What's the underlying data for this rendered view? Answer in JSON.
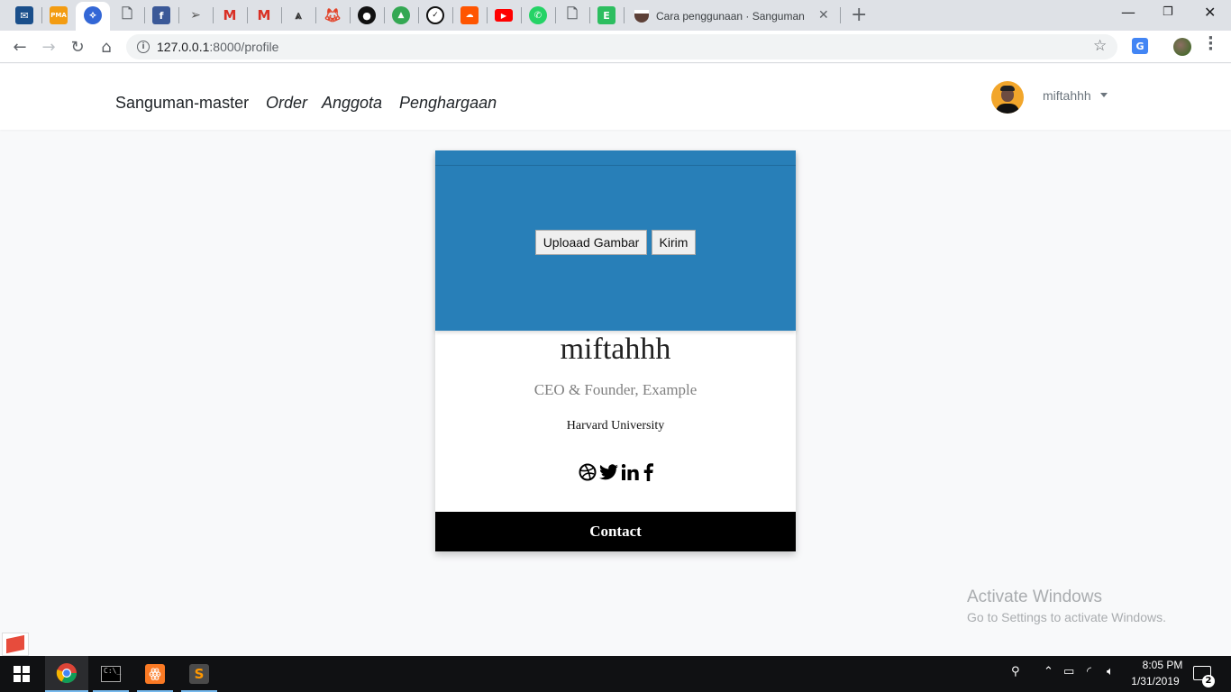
{
  "browser": {
    "tabs_icons": [
      "mail-icon",
      "phpmyadmin-icon",
      "chromium-icon",
      "doc-icon",
      "facebook-icon",
      "send-icon",
      "gmail-icon",
      "gmail-icon",
      "altair-icon",
      "gitlab-icon",
      "github-icon",
      "map-icon",
      "timer-icon",
      "soundcloud-icon",
      "youtube-icon",
      "whatsapp-icon",
      "doc-icon",
      "evernote-icon"
    ],
    "active_tab_title": "Cara penggunaan · Sanguman",
    "url_host": "127.0.0.1",
    "url_rest": ":8000/profile",
    "translate_label": "G",
    "new_tab": "+",
    "close_tab": "✕"
  },
  "nav": {
    "brand": "Sanguman-master",
    "links": [
      "Order",
      "Anggota",
      "Penghargaan"
    ],
    "username": "miftahhh"
  },
  "profile": {
    "upload_label": "Uploaad Gambar",
    "send_label": "Kirim",
    "name": "miftahhh",
    "title": "CEO & Founder, Example",
    "org": "Harvard University",
    "contact_label": "Contact",
    "socials": [
      "dribbble-icon",
      "twitter-icon",
      "linkedin-icon",
      "facebook-icon"
    ],
    "cover_color": "#287fb8"
  },
  "watermark": {
    "line1": "Activate Windows",
    "line2": "Go to Settings to activate Windows."
  },
  "taskbar": {
    "apps": [
      "chrome-icon",
      "terminal-icon",
      "xampp-icon",
      "sublime-icon"
    ],
    "time": "8:05 PM",
    "date": "1/31/2019",
    "notifications": "2"
  }
}
